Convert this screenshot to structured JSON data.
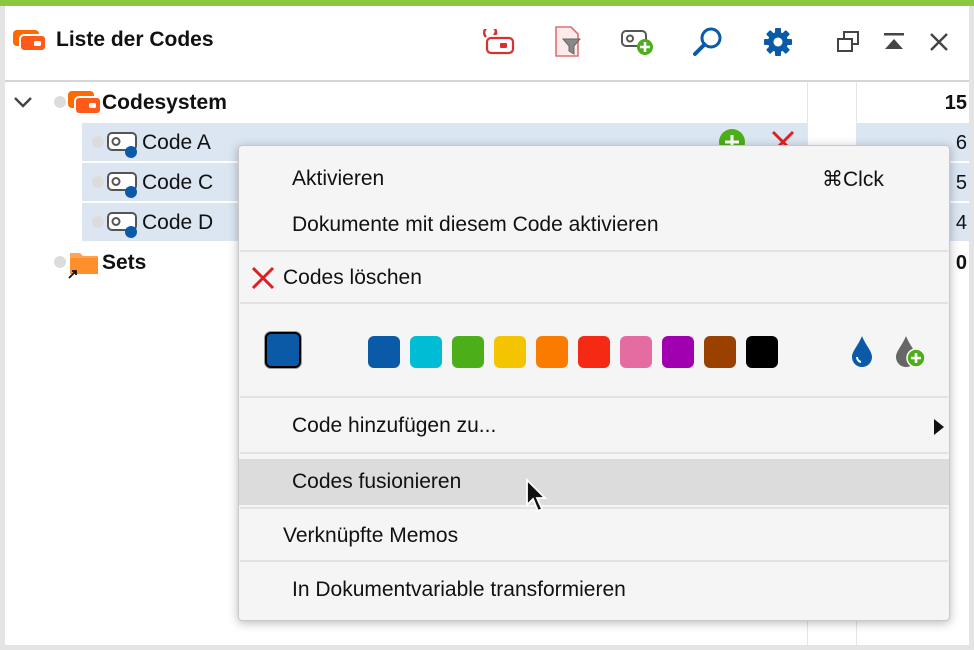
{
  "window": {
    "title": "Liste der Codes",
    "accent_color": "#8dc63f"
  },
  "toolbar": {
    "icons": [
      "activate-codes-icon",
      "filter-document-icon",
      "new-code-icon",
      "search-icon",
      "settings-gear-icon",
      "undock-window-icon",
      "maximize-up-icon",
      "close-icon"
    ]
  },
  "tree": {
    "root": {
      "label": "Codesystem",
      "count": "15"
    },
    "codes": [
      {
        "label": "Code A",
        "count": "6"
      },
      {
        "label": "Code C",
        "count": "5"
      },
      {
        "label": "Code D",
        "count": "4"
      }
    ],
    "sets": {
      "label": "Sets",
      "count": "0"
    }
  },
  "context_menu": {
    "activate": {
      "label": "Aktivieren",
      "shortcut": "⌘Clck"
    },
    "activate_docs": "Dokumente mit diesem Code aktivieren",
    "delete_codes": "Codes löschen",
    "current_color": "#0a5aa8",
    "colors": [
      "#0a5aa8",
      "#00bcd4",
      "#4caf1a",
      "#f5c400",
      "#fb7a00",
      "#f52a14",
      "#e56ca0",
      "#a100b0",
      "#9a4000",
      "#000000"
    ],
    "add_code_to": "Code hinzufügen zu...",
    "merge_codes": "Codes fusionieren",
    "linked_memos": "Verknüpfte Memos",
    "transform": "In Dokumentvariable transformieren"
  }
}
